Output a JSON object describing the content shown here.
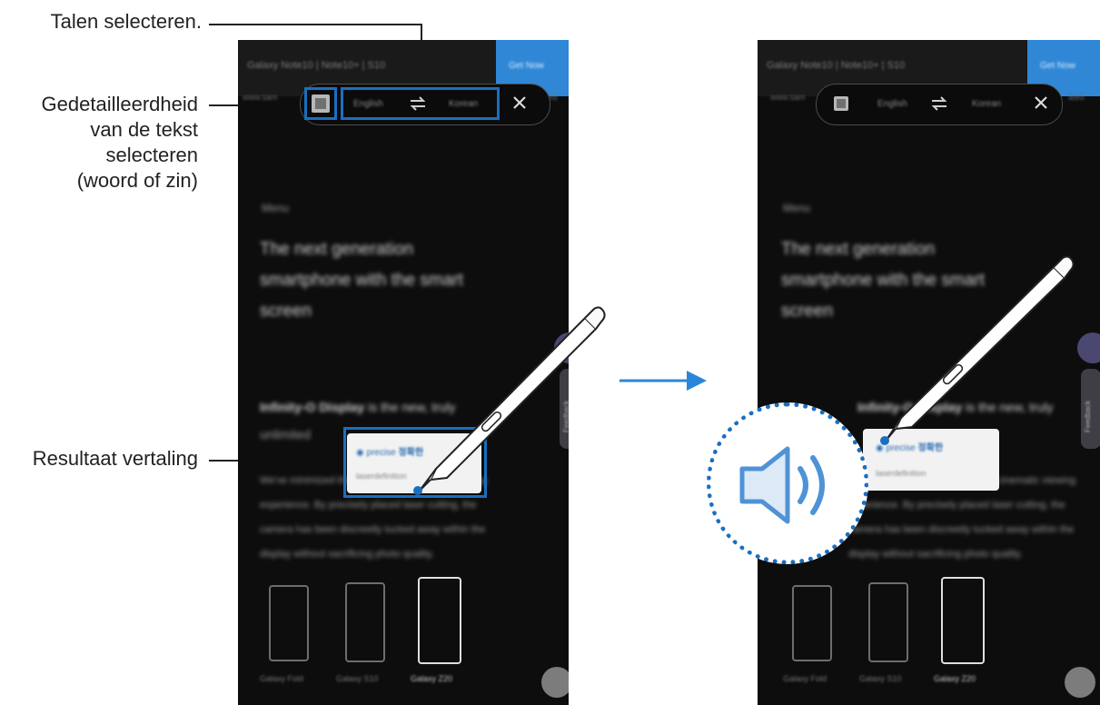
{
  "callouts": {
    "languages": "Talen selecteren.",
    "detail": [
      "Gedetailleerdheid",
      "van de tekst",
      "selecteren",
      "(woord of zin)"
    ],
    "result": "Resultaat vertaling"
  },
  "screen": {
    "title": "Galaxy Note10 | Note10+ | S10",
    "top_button": "Get Now",
    "side_left": "www.sam",
    "side_right": "ated",
    "toolbar": {
      "source_lang": "English",
      "swap_icon": "swap-icon",
      "target_lang": "Korean",
      "close_icon": "close-icon",
      "detail_icon": "text-granularity-icon"
    },
    "label": "Menu",
    "headline": [
      "The next generation",
      "smartphone with the smart",
      "screen"
    ],
    "section_title": "Infinity-O Display",
    "section_rest": "is the new, truly",
    "section_line2": "unlimited",
    "body": [
      "We've minimized the bezels for a cinematic viewing",
      "experience. By precisely placed laser cutting, the",
      "camera has been discreetly tucked away within the",
      "display without sacrificing photo quality."
    ],
    "popup_word": "precise",
    "popup_meaning": "정확한",
    "popup_sub": "laserdefinition",
    "sidebar_label": "Feedback",
    "devices": [
      "Galaxy Fold",
      "Galaxy S10",
      "Galaxy Z20"
    ]
  },
  "speaker_icon": "speaker-volume-icon",
  "arrow_icon": "arrow-right-icon",
  "colors": {
    "accent": "#1a6fc0",
    "arrow": "#2a87d8",
    "screen_bg": "#0d0d0d"
  }
}
